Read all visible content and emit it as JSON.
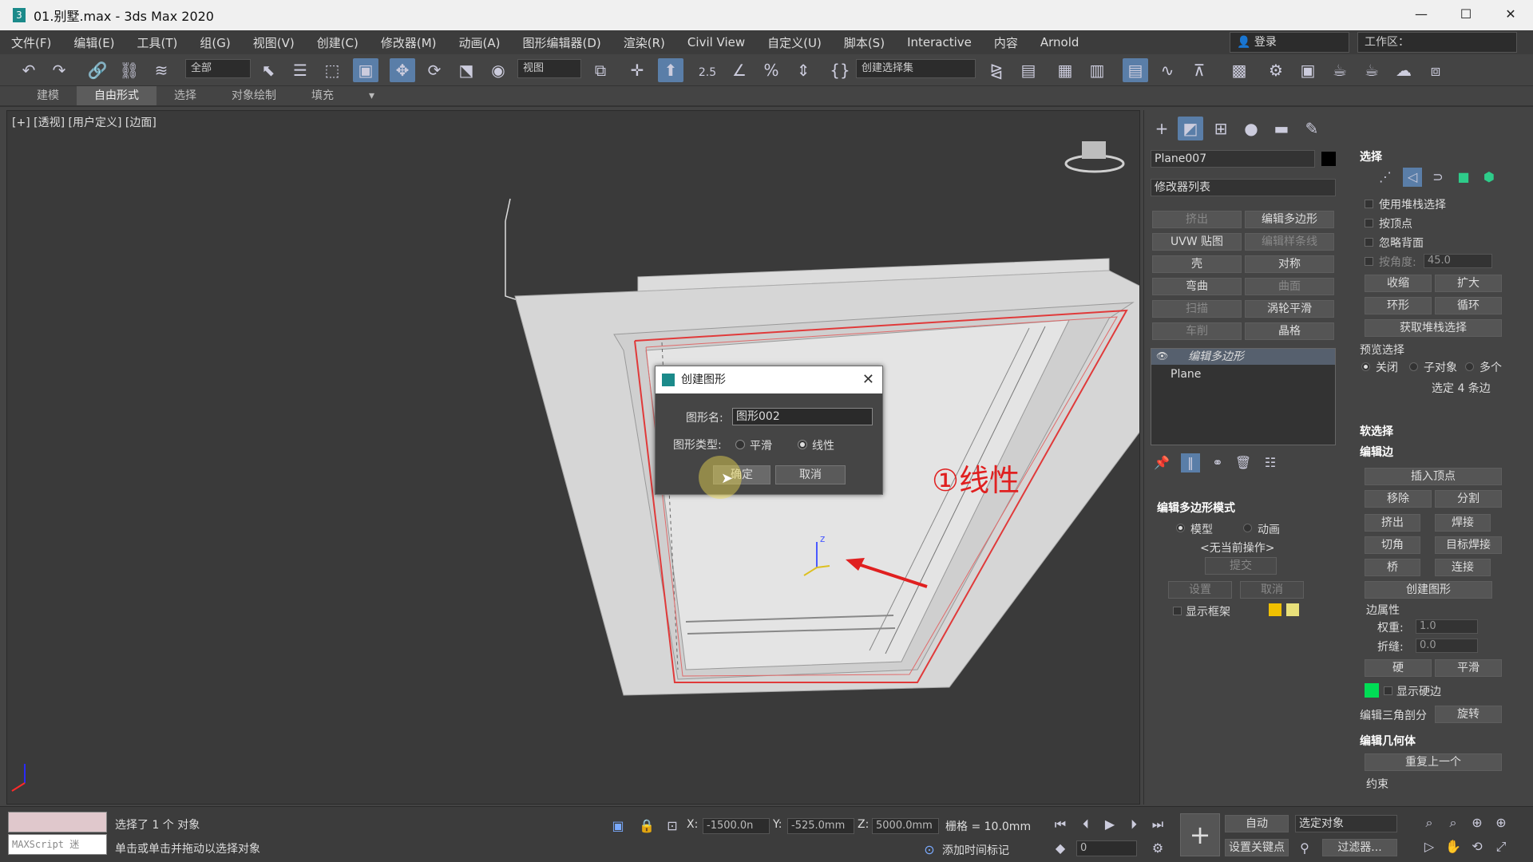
{
  "title_bar": {
    "text": "01.别墅.max - 3ds Max 2020"
  },
  "menu": [
    "文件(F)",
    "编辑(E)",
    "工具(T)",
    "组(G)",
    "视图(V)",
    "创建(C)",
    "修改器(M)",
    "动画(A)",
    "图形编辑器(D)",
    "渲染(R)",
    "Civil View",
    "自定义(U)",
    "脚本(S)",
    "Interactive",
    "内容",
    "Arnold"
  ],
  "login": "登录",
  "workspace": "工作区：",
  "toolbar": {
    "filter": "全部",
    "ref_coord": "视图",
    "snap_label": "2.5",
    "sel_set": "创建选择集"
  },
  "ribbon_tabs": [
    "建模",
    "自由形式",
    "选择",
    "对象绘制",
    "填充"
  ],
  "ribbon_active": 1,
  "viewport": {
    "label": "[+] [透视] [用户定义] [边面]",
    "annotation": "①线性"
  },
  "dialog": {
    "title": "创建图形",
    "name_label": "图形名:",
    "name_value": "图形002",
    "type_label": "图形类型:",
    "opt_smooth": "平滑",
    "opt_linear": "线性",
    "selected": "线性",
    "ok": "确定",
    "cancel": "取消"
  },
  "panel": {
    "object_name": "Plane007",
    "modifier_list": "修改器列表",
    "mod_buttons": [
      {
        "label": "挤出",
        "enabled": false
      },
      {
        "label": "编辑多边形",
        "enabled": true
      },
      {
        "label": "UVW 贴图",
        "enabled": true
      },
      {
        "label": "编辑样条线",
        "enabled": false
      },
      {
        "label": "壳",
        "enabled": true
      },
      {
        "label": "对称",
        "enabled": true
      },
      {
        "label": "弯曲",
        "enabled": true
      },
      {
        "label": "曲面",
        "enabled": false
      },
      {
        "label": "扫描",
        "enabled": false
      },
      {
        "label": "涡轮平滑",
        "enabled": true
      },
      {
        "label": "车削",
        "enabled": false
      },
      {
        "label": "晶格",
        "enabled": true
      }
    ],
    "stack": [
      "编辑多边形",
      "Plane"
    ],
    "edit_mode": {
      "header": "编辑多边形模式",
      "model": "模型",
      "anim": "动画",
      "no_op": "<无当前操作>",
      "commit": "提交",
      "settings": "设置",
      "cancel": "取消",
      "show_cage": "显示框架"
    }
  },
  "right_panel": {
    "selection_header": "选择",
    "use_stack": "使用堆栈选择",
    "by_vertex": "按顶点",
    "ignore_back": "忽略背面",
    "angle_label": "按角度:",
    "angle_value": "45.0",
    "shrink": "收缩",
    "grow": "扩大",
    "ring": "环形",
    "loop": "循环",
    "get_stack": "获取堆栈选择",
    "preview_label": "预览选择",
    "preview_off": "关闭",
    "preview_sub": "子对象",
    "preview_multi": "多个",
    "selected_text": "选定 4 条边",
    "soft_sel": "软选择",
    "edit_edges": "编辑边",
    "insert_vertex": "插入顶点",
    "remove": "移除",
    "split": "分割",
    "extrude": "挤出",
    "weld": "焊接",
    "chamfer": "切角",
    "target_weld": "目标焊接",
    "bridge": "桥",
    "connect": "连接",
    "create_shape": "创建图形",
    "edge_props": "边属性",
    "weight_label": "权重:",
    "weight_value": "1.0",
    "crease_label": "折缝:",
    "crease_value": "0.0",
    "hard": "硬",
    "smooth": "平滑",
    "show_hard": "显示硬边",
    "edit_tri": "编辑三角剖分",
    "turn": "旋转",
    "edit_geo": "编辑几何体",
    "repeat_last": "重复上一个",
    "constraints": "约束"
  },
  "status": {
    "maxscript": "MAXScript 迷",
    "selected": "选择了 1 个 对象",
    "prompt": "单击或单击并拖动以选择对象",
    "x": "-1500.0n",
    "y": "-525.0mm",
    "z": "5000.0mm",
    "grid": "栅格 = 10.0mm",
    "add_tag": "添加时间标记",
    "auto": "自动",
    "sel_obj": "选定对象",
    "set_key": "设置关键点",
    "filters": "过滤器...",
    "frame": "0"
  },
  "colors": {
    "accent": "#5a7ea8",
    "annotation": "#e02020",
    "swatch_green": "#00dd55",
    "swatch_yellow": "#f0c000"
  }
}
